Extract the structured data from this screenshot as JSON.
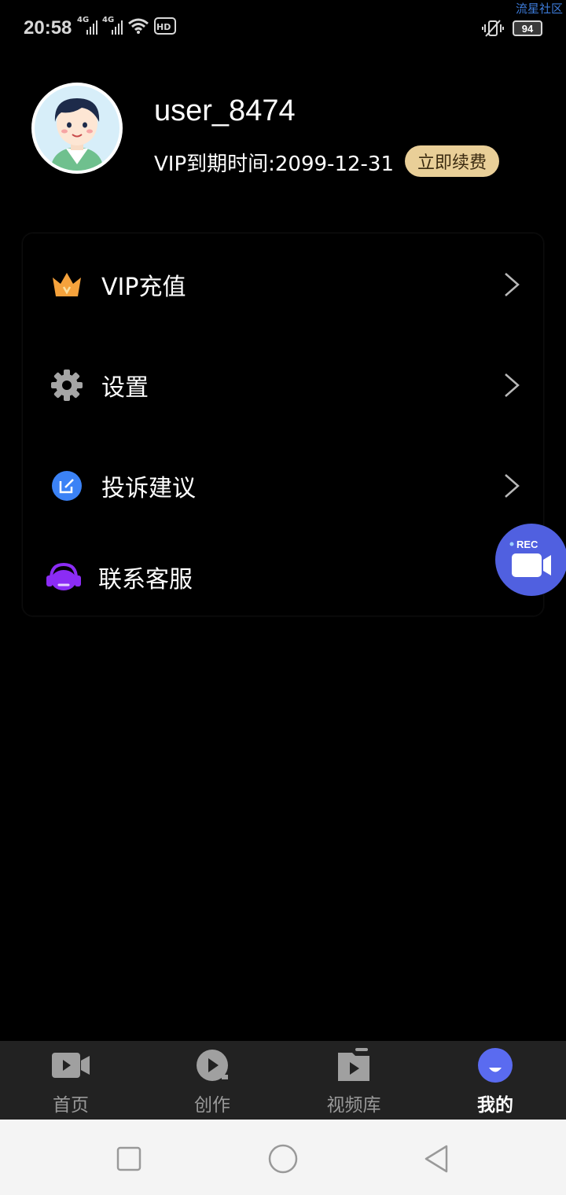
{
  "status_bar": {
    "time": "20:58",
    "signal_1_label": "4G",
    "signal_2_label": "4G",
    "hd_label": "HD",
    "battery": "94",
    "corner_tag": "流星社区"
  },
  "profile": {
    "username": "user_8474",
    "vip_expiry": "VIP到期时间:2099-12-31",
    "renew_button": "立即续费"
  },
  "menu": {
    "items": [
      {
        "label": "VIP充值",
        "icon": "crown-icon",
        "color": "#f5a23c"
      },
      {
        "label": "设置",
        "icon": "gear-icon",
        "color": "#9a9a9a"
      },
      {
        "label": "投诉建议",
        "icon": "edit-icon",
        "color": "#3b82f6"
      },
      {
        "label": "联系客服",
        "icon": "headset-icon",
        "color": "#8b2cf5"
      }
    ]
  },
  "rec_button": {
    "label": "REC"
  },
  "bottom_nav": {
    "items": [
      {
        "label": "首页",
        "icon": "video-camera-icon",
        "active": false
      },
      {
        "label": "创作",
        "icon": "play-circle-icon",
        "active": false
      },
      {
        "label": "视频库",
        "icon": "video-library-icon",
        "active": false
      },
      {
        "label": "我的",
        "icon": "profile-face-icon",
        "active": true
      }
    ]
  },
  "colors": {
    "background": "#000000",
    "accent_gold": "#e9cf98",
    "active_nav": "#5a6bf0"
  }
}
